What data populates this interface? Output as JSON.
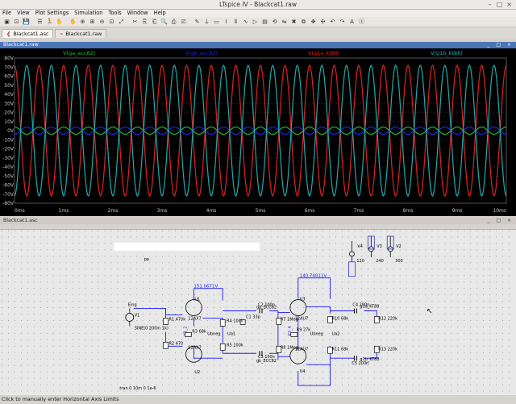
{
  "window": {
    "title": "LTspice IV - Blackcat1.raw"
  },
  "menu": [
    "File",
    "View",
    "Plot Settings",
    "Simulation",
    "Tools",
    "Window",
    "Help"
  ],
  "toolbar_icons": [
    "new-schematic-icon",
    "open-icon",
    "save-icon",
    "control-panel-icon",
    "run-icon",
    "halt-icon",
    "pan-icon",
    "zoom-in-icon",
    "zoom-rect-icon",
    "zoom-out-icon",
    "zoom-fit-icon",
    "autorange-icon",
    "cut-icon",
    "copy-icon",
    "paste-icon",
    "find-icon",
    "print-icon",
    "print-preview-icon",
    "wire-icon",
    "ground-icon",
    "label-icon",
    "resistor-icon",
    "capacitor-icon",
    "inductor-icon",
    "diode-icon",
    "component-icon",
    "rotate-icon",
    "mirror-icon",
    "delete-icon",
    "duplicate-icon",
    "move-icon",
    "drag-icon",
    "undo-icon",
    "redo-icon",
    "text-icon",
    "spice-directive-icon"
  ],
  "tabs": [
    {
      "label": "Blackcat1.asc",
      "icon": "schematic-icon",
      "active": true
    },
    {
      "label": "Blackcat1.raw",
      "icon": "waveform-icon",
      "active": false
    }
  ],
  "waveform_panel": {
    "title": "Blackcat1.raw",
    "background": "#000000",
    "traces": [
      {
        "label": "V(ga_ecc82)",
        "color": "#22bb33"
      },
      {
        "label": "V(gk_ecc82)",
        "color": "#2222ee"
      },
      {
        "label": "V(g1a_kt88)",
        "color": "#dd2222"
      },
      {
        "label": "V(g1b_kt88)",
        "color": "#22aaaa"
      }
    ]
  },
  "chart_data": {
    "type": "line",
    "xlabel": "",
    "ylabel": "",
    "xlim": [
      0,
      10
    ],
    "ylim": [
      -80,
      80
    ],
    "x_ticks": [
      "0ms",
      "1ms",
      "2ms",
      "3ms",
      "4ms",
      "5ms",
      "6ms",
      "7ms",
      "8ms",
      "9ms",
      "10ms"
    ],
    "y_ticks": [
      "80V",
      "70V",
      "60V",
      "50V",
      "40V",
      "30V",
      "20V",
      "10V",
      "0V",
      "-10V",
      "-20V",
      "-30V",
      "-40V",
      "-50V",
      "-60V",
      "-70V",
      "-80V"
    ],
    "grid": true,
    "frequency_khz": 2,
    "series": [
      {
        "name": "V(ga_ecc82)",
        "amplitude_v": 4,
        "phase_deg": 0
      },
      {
        "name": "V(gk_ecc82)",
        "amplitude_v": 4,
        "phase_deg": 180
      },
      {
        "name": "V(g1a_kt88)",
        "amplitude_v": 72,
        "phase_deg": 0
      },
      {
        "name": "V(g1b_kt88)",
        "amplitude_v": 72,
        "phase_deg": 180
      }
    ]
  },
  "schematic_panel": {
    "title": "Blackcat1.asc",
    "sources": [
      {
        "name": "V4",
        "value": "120"
      },
      {
        "name": "V3",
        "value": "240"
      },
      {
        "name": "V2",
        "value": "300"
      }
    ],
    "net_voltages": [
      "151.0671V",
      "140.74011V"
    ],
    "tubes": [
      "U1 12AX7",
      "U2 12AX7",
      "U3 12AU7",
      "U4 12AU7"
    ],
    "labels": {
      "input": "Eing",
      "v1": "V1",
      "v1_value": "SINE(0 200m 1k)",
      "sim_directive": ".tran 0 10m 0 1e-6",
      "pp": "pp",
      "ga": "ga_ECC82",
      "gk": "gk_ECC82",
      "g1a": "g1a_KT88",
      "g1b": "g1b_KT88",
      "ubneg1": "Ubneg",
      "ua1": "Ua1",
      "ubneg2": "Ubneg",
      "ua2": "Ua2",
      "k12": "K1_2",
      "k34": "K3_4"
    },
    "components": {
      "R1": "R1 470k",
      "R2": "R2 470",
      "R3": "R3 68k",
      "R4": "R4 100k",
      "R5": "R5 100k",
      "C1": "C1 33p",
      "C2": "C2 100n",
      "C3": "C3 100n",
      "R7": "R7 1Meg",
      "R8": "R8 1Meg",
      "R9": "R9 27k",
      "R10": "R10 68k",
      "R11": "R11 68k",
      "C4": "C4 200n",
      "C5": "C5 200n",
      "R12": "R12 220k",
      "R13": "R13 220k"
    }
  },
  "status": {
    "text": "Click to manually enter Horizontal Axis Limits"
  }
}
